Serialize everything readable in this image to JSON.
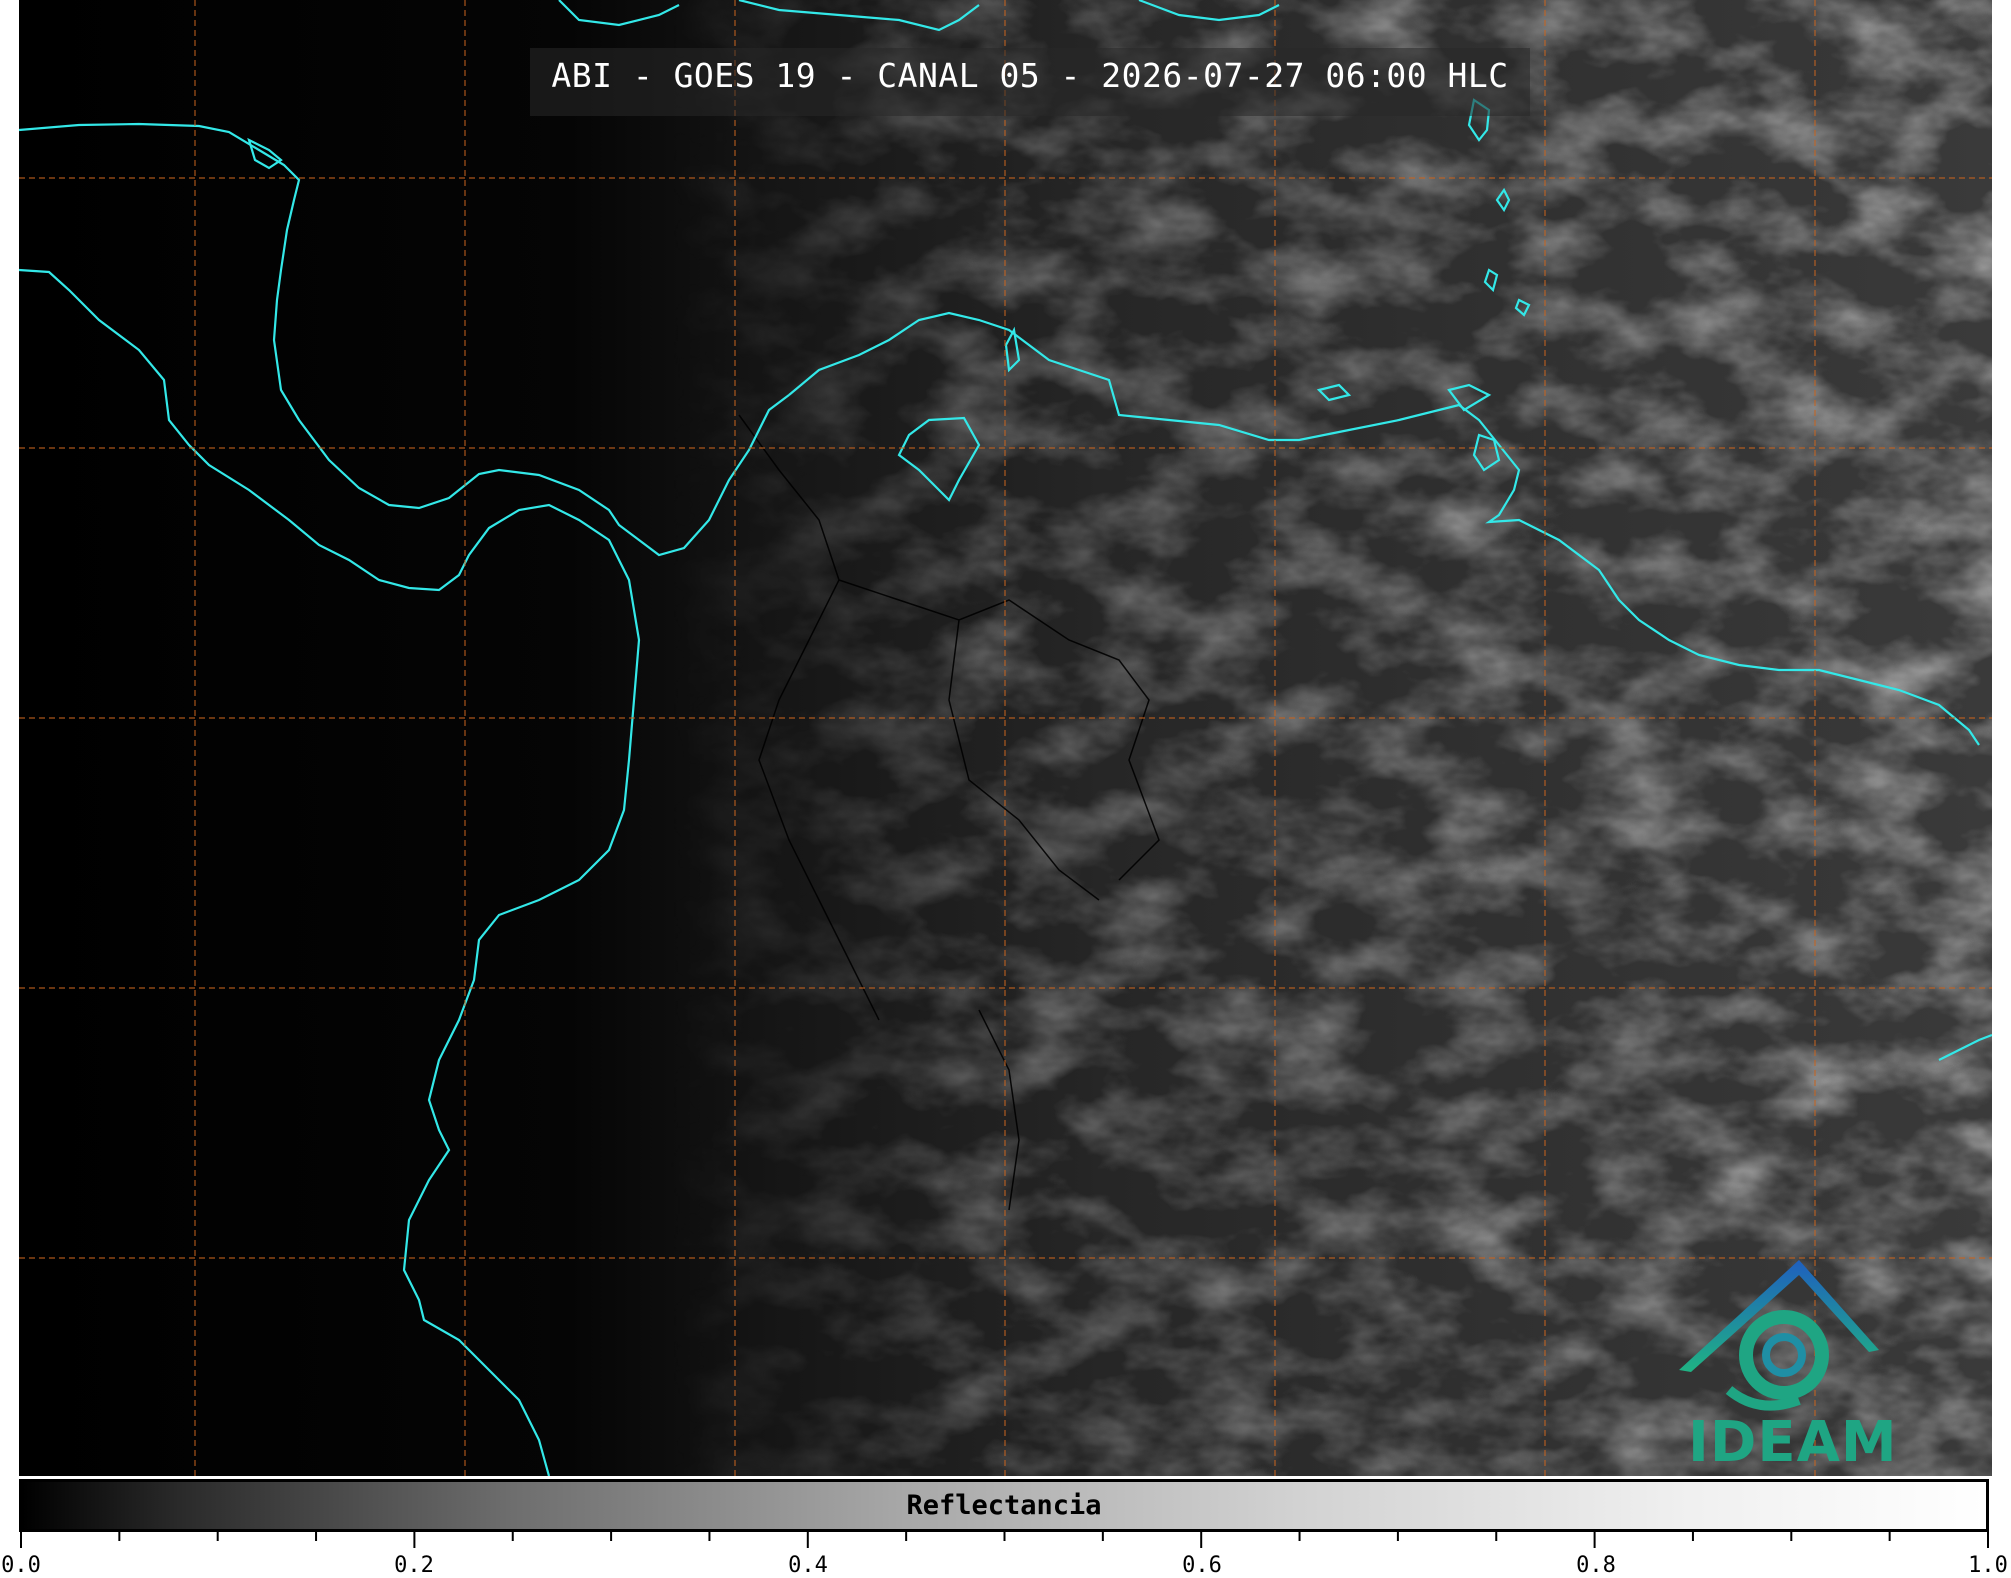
{
  "title": "ABI - GOES 19 - CANAL 05 - 2026-07-27 06:00 HLC",
  "logo": {
    "name": "IDEAM",
    "text": "IDEAM",
    "colors": [
      "#1f6fbf",
      "#1fa583"
    ]
  },
  "colorbar": {
    "label": "Reflectancia",
    "range": [
      0.0,
      1.0
    ],
    "ticks": [
      "0.0",
      "0.2",
      "0.4",
      "0.6",
      "0.8",
      "1.0"
    ],
    "colormap": "grayscale"
  },
  "map": {
    "coastline_color": "#33e8e8",
    "grid_color": "#c8641e",
    "border_color": "#000000",
    "grid_lines": "dashed"
  }
}
